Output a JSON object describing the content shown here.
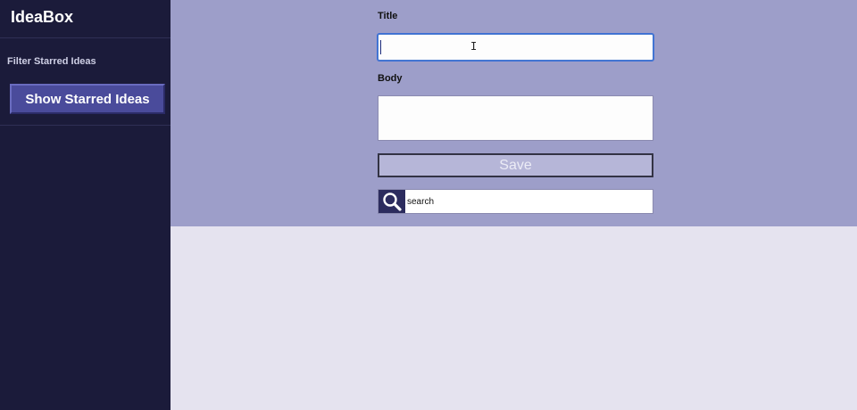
{
  "sidebar": {
    "logo": "IdeaBox",
    "filter_label": "Filter Starred Ideas",
    "show_starred_label": "Show Starred Ideas"
  },
  "form": {
    "title_label": "Title",
    "title_value": "",
    "body_label": "Body",
    "body_value": "",
    "save_label": "Save",
    "search_value": "search",
    "search_icon": "search-icon"
  },
  "colors": {
    "sidebar_bg": "#1b1b3a",
    "form_bg": "#9d9ec9",
    "content_bg": "#e5e3ef",
    "accent_button": "#4a4b9b"
  }
}
